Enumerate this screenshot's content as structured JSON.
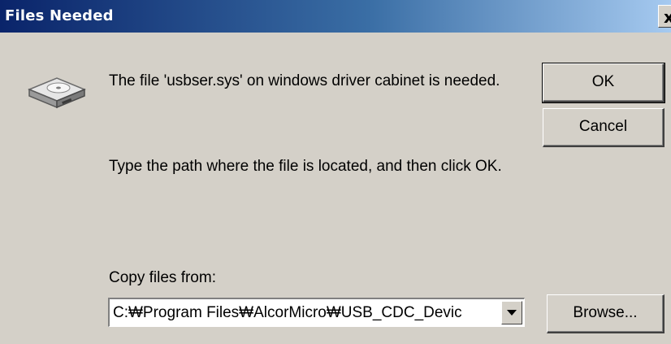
{
  "window": {
    "title": "Files Needed",
    "close_glyph": "x"
  },
  "icon": "hard-drive-icon",
  "message": {
    "line1": "The file 'usbser.sys' on windows driver cabinet is needed.",
    "line2": "Type the path where the file is located, and then click OK."
  },
  "copy_from": {
    "label": "Copy files from:",
    "value": "C:₩Program Files₩AlcorMicro₩USB_CDC_Devic"
  },
  "buttons": {
    "ok": "OK",
    "cancel": "Cancel",
    "browse": "Browse..."
  },
  "colors": {
    "titlebar_start": "#0a246a",
    "titlebar_end": "#a6caf0",
    "dialog_bg": "#d4d0c8"
  }
}
